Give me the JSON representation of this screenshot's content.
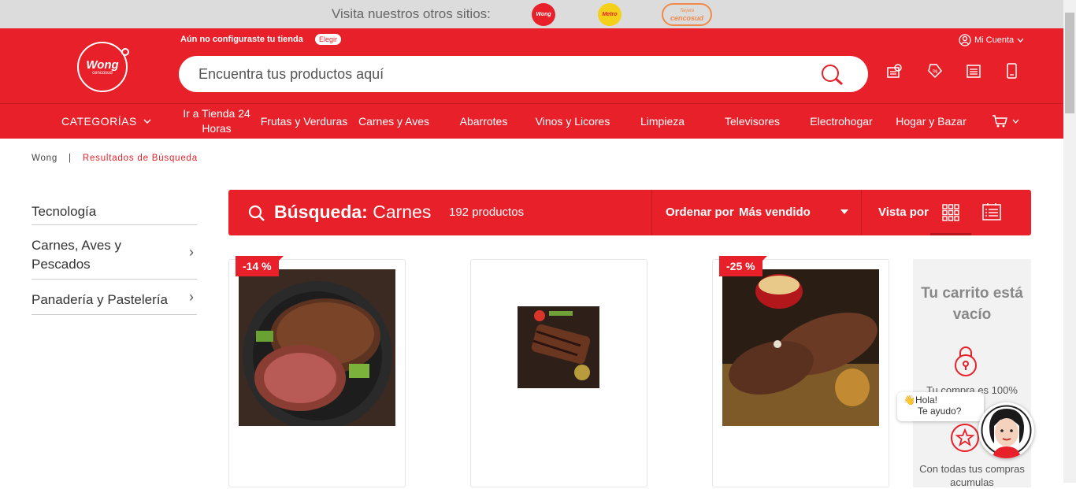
{
  "topbar": {
    "visit_text": "Visita nuestros otros sitios:",
    "sites": [
      {
        "label": "Wong",
        "color": "#e8202a"
      },
      {
        "label": "Metro",
        "color": "#f5d01a"
      },
      {
        "label": "cencosud",
        "sub": "Tarjeta"
      }
    ]
  },
  "header": {
    "logo_text": "Wong",
    "logo_sub": "cencosud",
    "store_message": "Aún no configuraste tu tienda",
    "elegir_label": "Elegir",
    "search_placeholder": "Encuentra tus productos aquí",
    "account_label": "Mi Cuenta",
    "icons": [
      "store-locator-icon",
      "coupon-icon",
      "list-icon",
      "mobile-icon"
    ]
  },
  "nav": {
    "categories_label": "CATEGORÍAS",
    "items": [
      {
        "label": "Ir a Tienda 24 Horas"
      },
      {
        "label": "Frutas y Verduras"
      },
      {
        "label": "Carnes y Aves"
      },
      {
        "label": "Abarrotes"
      },
      {
        "label": "Vinos y Licores"
      },
      {
        "label": "Limpieza"
      },
      {
        "label": "Televisores"
      },
      {
        "label": "Electrohogar"
      },
      {
        "label": "Hogar y Bazar"
      }
    ]
  },
  "breadcrumb": {
    "home": "Wong",
    "separator": "|",
    "current": "Resultados de Búsqueda"
  },
  "sidebar": {
    "items": [
      {
        "label": "Tecnología"
      },
      {
        "label": "Carnes, Aves y Pescados"
      },
      {
        "label": "Panadería y Pastelería"
      }
    ]
  },
  "results": {
    "search_label": "Búsqueda:",
    "query": "Carnes",
    "count": "192 productos",
    "sort_label": "Ordenar por",
    "sort_value": "Más vendido",
    "view_label": "Vista por"
  },
  "products": [
    {
      "badge": "-14 %"
    },
    {
      "badge": ""
    },
    {
      "badge": "-25 %"
    }
  ],
  "cart": {
    "title": "Tu carrito está vacío",
    "line1": "Tu compra es 100%",
    "line2": "Con todas tus compras acumulas"
  },
  "chat": {
    "greeting": "Hola!",
    "help": "Te ayudo?"
  },
  "colors": {
    "brand_red": "#e8202a",
    "topbar_gray": "#dcdcdc"
  }
}
